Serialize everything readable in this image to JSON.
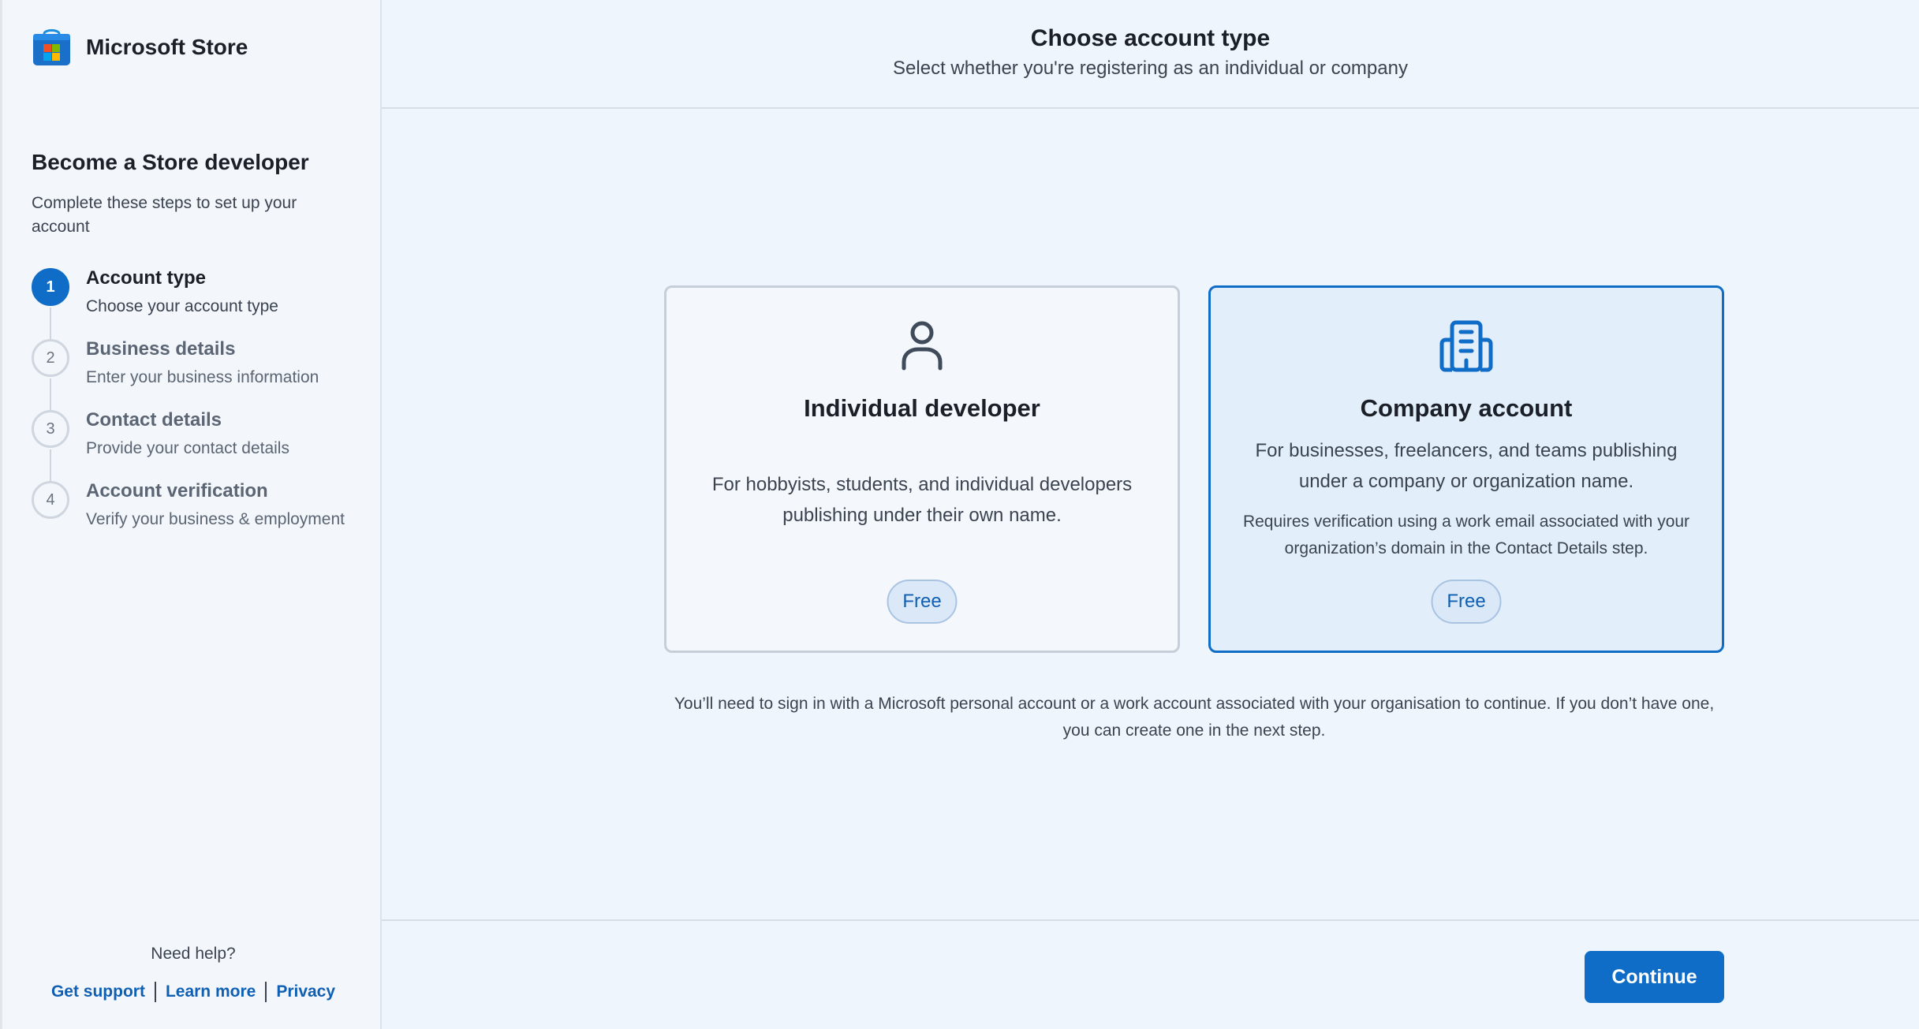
{
  "brand": {
    "name": "Microsoft Store",
    "icon": "microsoft-store-bag-icon"
  },
  "sidebar": {
    "title": "Become a Store developer",
    "subtitle": "Complete these steps to set up your account",
    "steps": [
      {
        "number": "1",
        "title": "Account type",
        "description": "Choose your account type",
        "active": true
      },
      {
        "number": "2",
        "title": "Business details",
        "description": "Enter your business information",
        "active": false
      },
      {
        "number": "3",
        "title": "Contact details",
        "description": "Provide your contact details",
        "active": false
      },
      {
        "number": "4",
        "title": "Account verification",
        "description": "Verify your business & employment",
        "active": false
      }
    ],
    "help_label": "Need help?",
    "links": {
      "support": "Get support",
      "learn": "Learn more",
      "privacy": "Privacy"
    }
  },
  "header": {
    "title": "Choose account type",
    "subtitle": "Select whether you're registering as an individual or company"
  },
  "cards": {
    "individual": {
      "icon": "person-icon",
      "title": "Individual developer",
      "description": "For hobbyists, students, and individual developers publishing under their own name.",
      "price": "Free",
      "selected": false
    },
    "company": {
      "icon": "building-icon",
      "title": "Company account",
      "description": "For businesses, freelancers, and teams publishing under a company or organization name.",
      "note": "Requires verification using a work email associated with your organization’s domain in the Contact Details step.",
      "price": "Free",
      "selected": true
    }
  },
  "notice": "You’ll need to sign in with a Microsoft personal account or a work account associated with your organisation to continue. If you don’t have one, you can create one in the next step.",
  "footer": {
    "continue_label": "Continue"
  },
  "colors": {
    "accent": "#0f6cc7",
    "background": "#eff5fc",
    "selected_card": "#e3eefb",
    "link": "#0f5fb3"
  }
}
